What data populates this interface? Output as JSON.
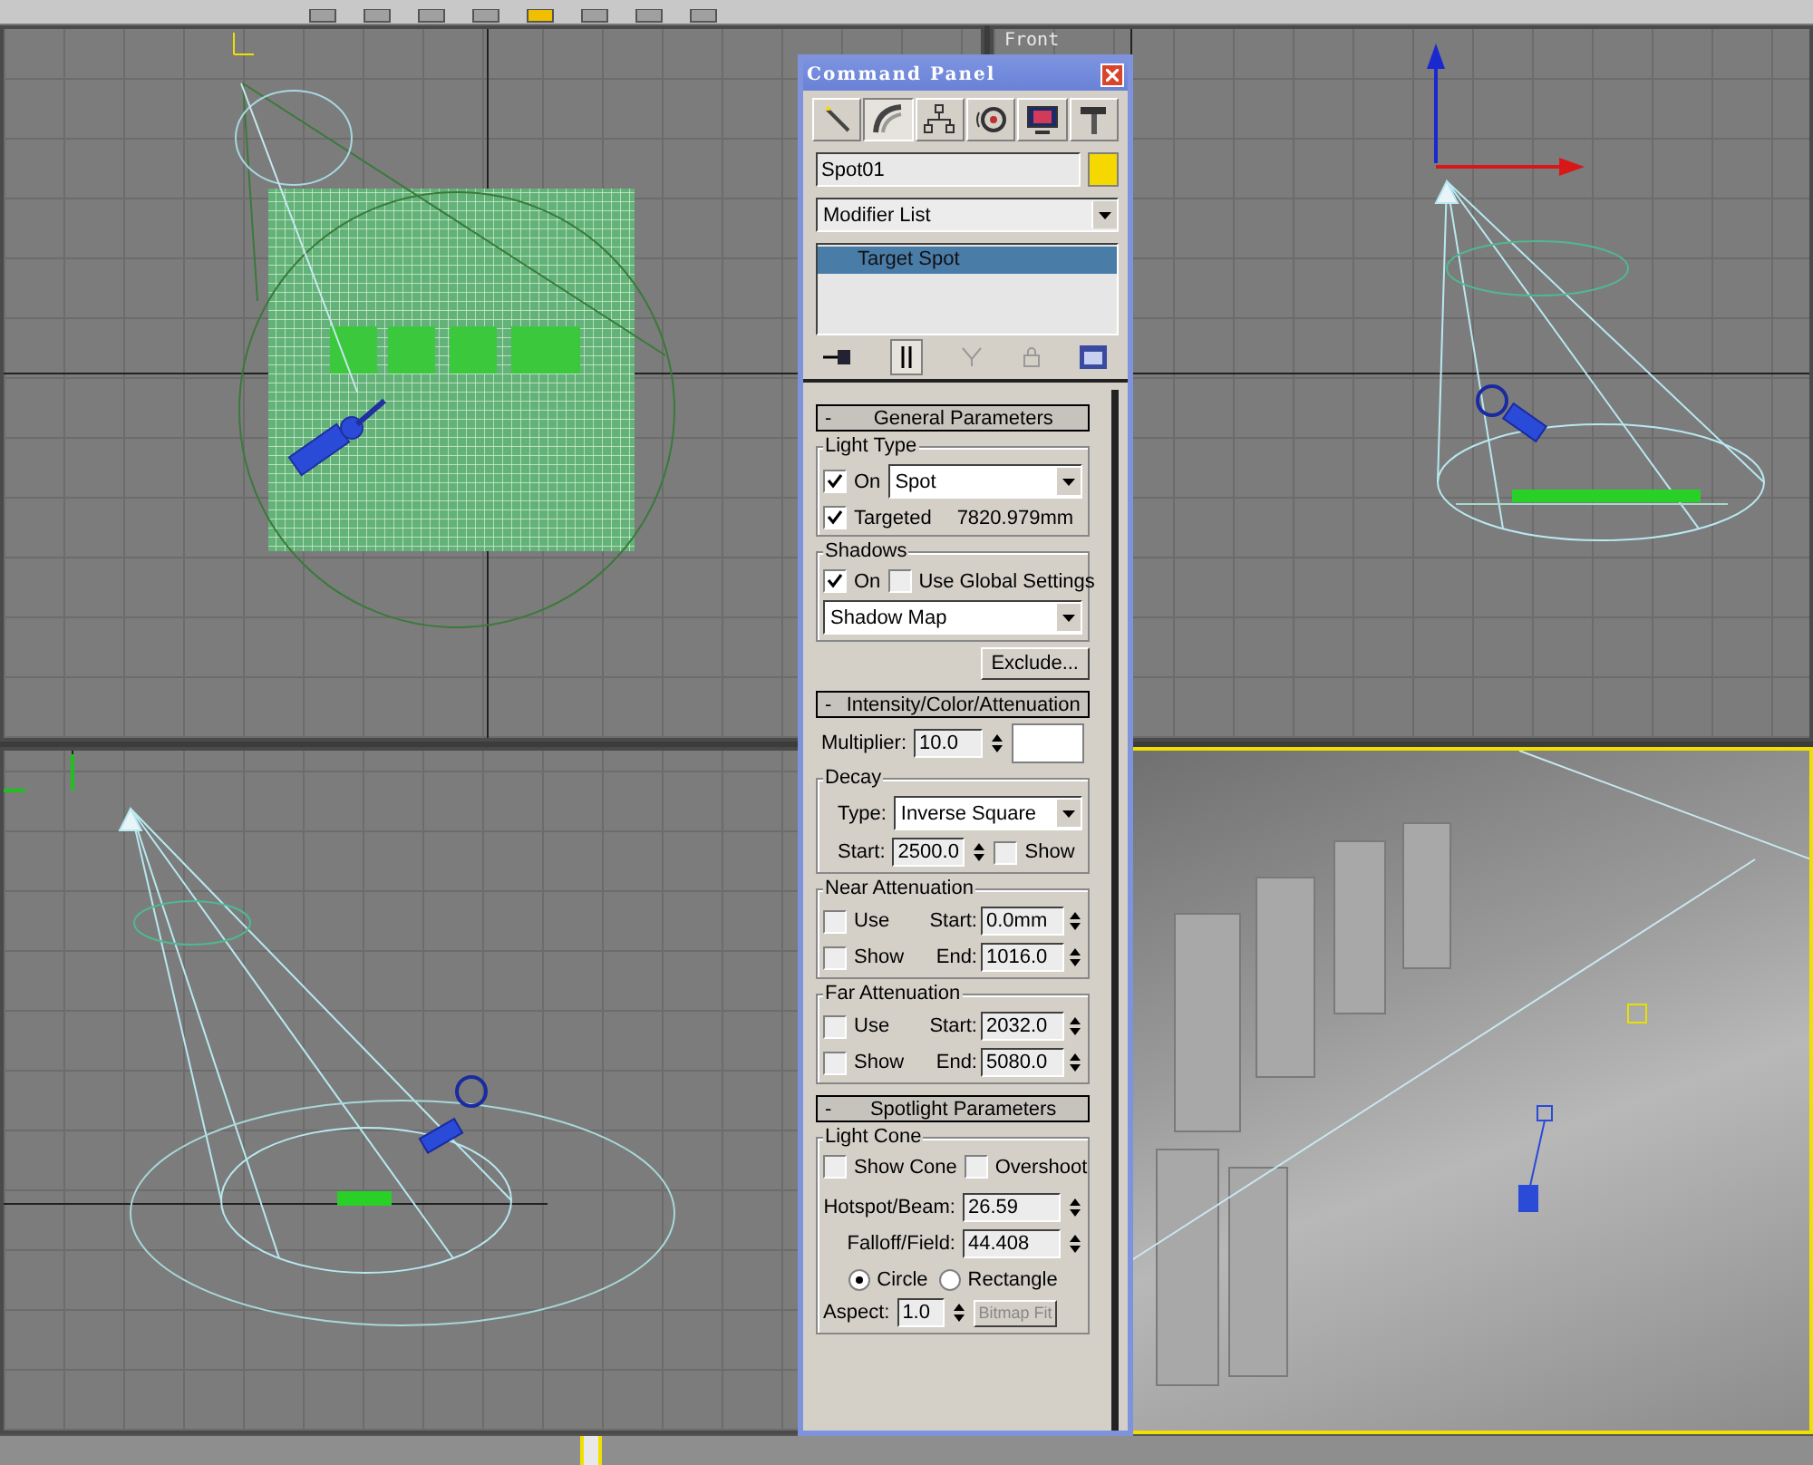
{
  "viewports": [
    {
      "kind": "top",
      "selected": false
    },
    {
      "kind": "front",
      "label": "Front",
      "selected": false
    },
    {
      "kind": "left",
      "selected": false
    },
    {
      "kind": "perspective",
      "selected": true
    }
  ],
  "time_slider": {
    "level": 0.32
  },
  "command_panel": {
    "title": "Command Panel",
    "tabs": [
      {
        "kind": "create",
        "selected": false
      },
      {
        "kind": "modify",
        "selected": true
      },
      {
        "kind": "hierarchy",
        "selected": false
      },
      {
        "kind": "motion",
        "selected": false
      },
      {
        "kind": "display",
        "selected": false
      },
      {
        "kind": "utilities",
        "selected": false
      }
    ],
    "object": {
      "name": "Spot01",
      "color": "#f5d800"
    },
    "modifier_list": "Modifier List",
    "stack": [
      {
        "label": "Target Spot",
        "selected": true
      }
    ],
    "general_parameters": {
      "sign": "-",
      "title": "General Parameters",
      "light_type": {
        "title": "Light Type",
        "on": {
          "label": "On",
          "checked": true
        },
        "type": "Spot",
        "targeted": {
          "label": "Targeted",
          "checked": true
        },
        "distance": "7820.979mm"
      },
      "shadows": {
        "title": "Shadows",
        "on": {
          "label": "On",
          "checked": true
        },
        "use_global": {
          "label": "Use Global Settings",
          "checked": false
        },
        "type": "Shadow Map"
      },
      "exclude": "Exclude..."
    },
    "intensity": {
      "sign": "-",
      "title": "Intensity/Color/Attenuation",
      "multiplier_label": "Multiplier:",
      "multiplier": "10.0",
      "color": "#ffffff",
      "decay": {
        "title": "Decay",
        "type_label": "Type:",
        "type": "Inverse Square",
        "start_label": "Start:",
        "start": "2500.0",
        "show": {
          "label": "Show",
          "checked": false
        }
      },
      "attenuation": [
        {
          "title": "Near Attenuation",
          "use": {
            "label": "Use",
            "checked": false
          },
          "show": {
            "label": "Show",
            "checked": false
          },
          "start_label": "Start:",
          "start": "0.0mm",
          "end_label": "End:",
          "end": "1016.0"
        },
        {
          "title": "Far Attenuation",
          "use": {
            "label": "Use",
            "checked": false
          },
          "show": {
            "label": "Show",
            "checked": false
          },
          "start_label": "Start:",
          "start": "2032.0",
          "end_label": "End:",
          "end": "5080.0"
        }
      ]
    },
    "spotlight": {
      "sign": "-",
      "title": "Spotlight Parameters",
      "cone_title": "Light Cone",
      "show_cone": {
        "label": "Show Cone",
        "checked": false
      },
      "overshoot": {
        "label": "Overshoot",
        "checked": false
      },
      "hotspot_label": "Hotspot/Beam:",
      "hotspot": "26.59",
      "falloff_label": "Falloff/Field:",
      "falloff": "44.408",
      "shapes": [
        {
          "label": "Circle",
          "selected": true
        },
        {
          "label": "Rectangle",
          "selected": false
        }
      ],
      "aspect_label": "Aspect:",
      "aspect": "1.0",
      "bitmap_fit": "Bitmap Fit"
    }
  }
}
